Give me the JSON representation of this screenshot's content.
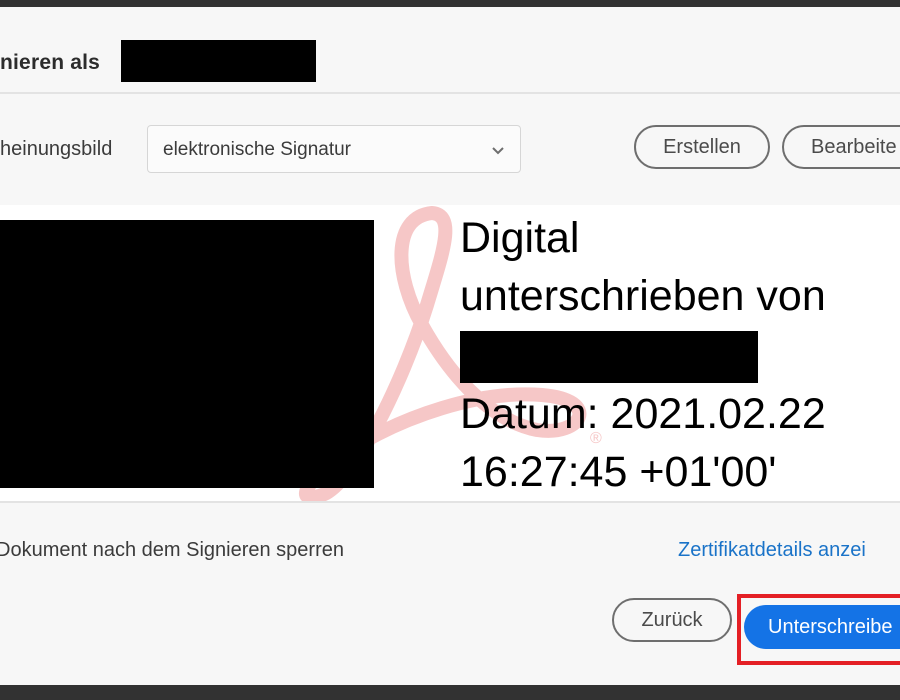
{
  "dialog": {
    "title": "nieren als",
    "appearance_label": "heinungsbild",
    "appearance_select": {
      "value": "elektronische Signatur",
      "icon": "chevron-down-icon"
    },
    "create_button": "Erstellen",
    "edit_button": "Bearbeite",
    "preview": {
      "lines": [
        "Digital",
        "unterschrieben von",
        "Datum: 2021.02.22",
        "16:27:45 +01'00'"
      ],
      "watermark": "acrobat-logo",
      "watermark_color": "#f6c7c7"
    },
    "lock_checkbox_label": "Dokument nach dem Signieren sperren",
    "certificate_link": "Zertifikatdetails anzei",
    "back_button": "Zurück",
    "sign_button": "Unterschreibe",
    "colors": {
      "accent": "#1473e6",
      "link": "#1a73c8",
      "highlight": "#e41f25",
      "redaction": "#000000",
      "window_chrome": "#323232"
    }
  }
}
